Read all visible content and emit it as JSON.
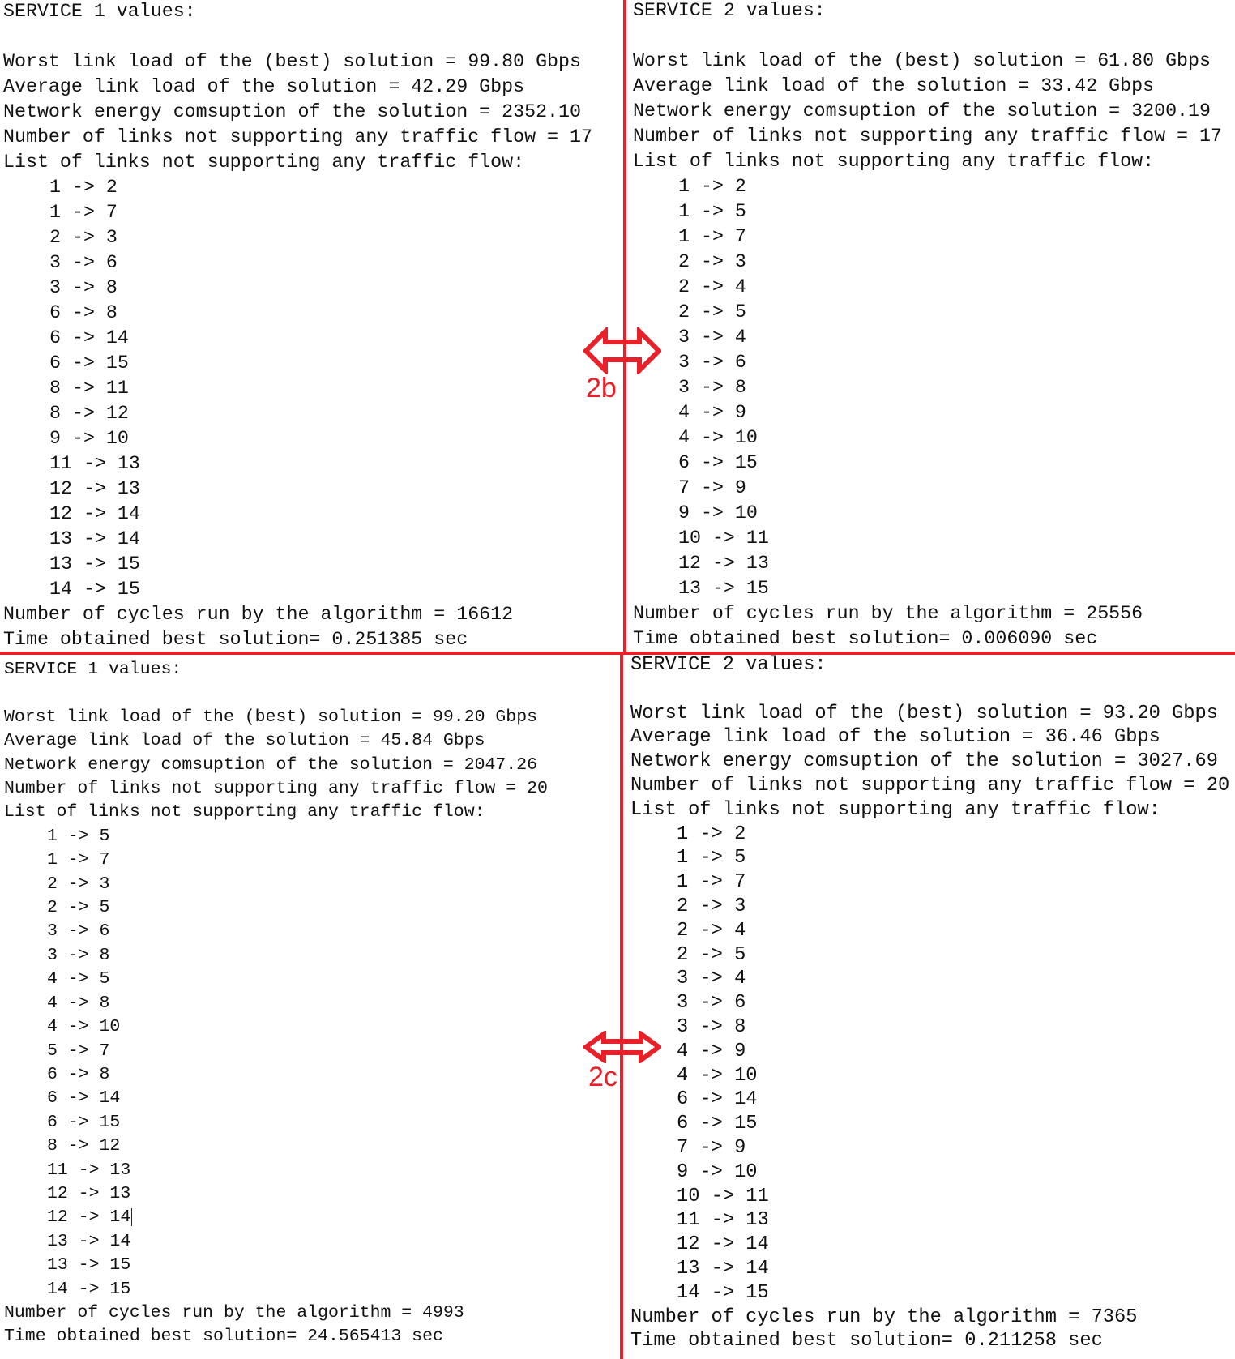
{
  "panels": [
    {
      "title": "SERVICE 1 values:",
      "stats": [
        "Worst link load of the (best) solution = 99.80 Gbps",
        "Average link load of the solution = 42.29 Gbps",
        "Network energy comsuption of the solution = 2352.10",
        "Number of links not supporting any traffic flow = 17",
        "List of links not supporting any traffic flow:"
      ],
      "links": [
        "1 -> 2",
        "1 -> 7",
        "2 -> 3",
        "3 -> 6",
        "3 -> 8",
        "6 -> 8",
        "6 -> 14",
        "6 -> 15",
        "8 -> 11",
        "8 -> 12",
        "9 -> 10",
        "11 -> 13",
        "12 -> 13",
        "12 -> 14",
        "13 -> 14",
        "13 -> 15",
        "14 -> 15"
      ],
      "footer": [
        "Number of cycles run by the algorithm = 16612",
        "Time obtained best solution= 0.251385 sec"
      ]
    },
    {
      "title": "SERVICE 2 values:",
      "stats": [
        "Worst link load of the (best) solution = 61.80 Gbps",
        "Average link load of the solution = 33.42 Gbps",
        "Network energy comsuption of the solution = 3200.19",
        "Number of links not supporting any traffic flow = 17",
        "List of links not supporting any traffic flow:"
      ],
      "links": [
        "1 -> 2",
        "1 -> 5",
        "1 -> 7",
        "2 -> 3",
        "2 -> 4",
        "2 -> 5",
        "3 -> 4",
        "3 -> 6",
        "3 -> 8",
        "4 -> 9",
        "4 -> 10",
        "6 -> 15",
        "7 -> 9",
        "9 -> 10",
        "10 -> 11",
        "12 -> 13",
        "13 -> 15"
      ],
      "footer": [
        "Number of cycles run by the algorithm = 25556",
        "Time obtained best solution= 0.006090 sec"
      ]
    },
    {
      "title": "SERVICE 1 values:",
      "stats": [
        "Worst link load of the (best) solution = 99.20 Gbps",
        "Average link load of the solution = 45.84 Gbps",
        "Network energy comsuption of the solution = 2047.26",
        "Number of links not supporting any traffic flow = 20",
        "List of links not supporting any traffic flow:"
      ],
      "links": [
        "1 -> 5",
        "1 -> 7",
        "2 -> 3",
        "2 -> 5",
        "3 -> 6",
        "3 -> 8",
        "4 -> 5",
        "4 -> 8",
        "4 -> 10",
        "5 -> 7",
        "6 -> 8",
        "6 -> 14",
        "6 -> 15",
        "8 -> 12",
        "11 -> 13",
        "12 -> 13",
        "12 -> 14",
        "13 -> 14",
        "13 -> 15",
        "14 -> 15"
      ],
      "footer": [
        "Number of cycles run by the algorithm = 4993",
        "Time obtained best solution= 24.565413 sec"
      ]
    },
    {
      "title": "SERVICE 2 values:",
      "stats": [
        "Worst link load of the (best) solution = 93.20 Gbps",
        "Average link load of the solution = 36.46 Gbps",
        "Network energy comsuption of the solution = 3027.69",
        "Number of links not supporting any traffic flow = 20",
        "List of links not supporting any traffic flow:"
      ],
      "links": [
        "1 -> 2",
        "1 -> 5",
        "1 -> 7",
        "2 -> 3",
        "2 -> 4",
        "2 -> 5",
        "3 -> 4",
        "3 -> 6",
        "3 -> 8",
        "4 -> 9",
        "4 -> 10",
        "6 -> 14",
        "6 -> 15",
        "7 -> 9",
        "9 -> 10",
        "10 -> 11",
        "11 -> 13",
        "12 -> 14",
        "13 -> 14",
        "14 -> 15"
      ],
      "footer": [
        "Number of cycles run by the algorithm = 7365",
        "Time obtained best solution= 0.211258 sec"
      ]
    }
  ],
  "annotations": {
    "top": "2b",
    "bottom": "2c"
  },
  "colors": {
    "accent": "#e8202a"
  }
}
